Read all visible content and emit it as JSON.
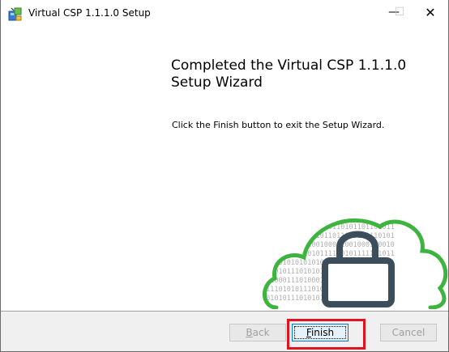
{
  "window": {
    "title": "Virtual CSP 1.1.1.0 Setup",
    "minimize_glyph": "—",
    "maximize_glyph": "☐",
    "close_glyph": "✕"
  },
  "content": {
    "heading": "Completed the Virtual CSP 1.1.1.0 Setup Wizard",
    "body": "Click the Finish button to exit the Setup Wizard."
  },
  "illustration": {
    "binary_lines": [
      "10101010",
      "01101011",
      "10110101",
      "00110010",
      "11101011",
      "01010101",
      "10101011",
      "10100011",
      "01110101",
      "10101011"
    ],
    "cloud_color": "#3db43d",
    "lock_color": "#3c4e5c"
  },
  "buttons": {
    "back_first": "B",
    "back_rest": "ack",
    "finish_first": "F",
    "finish_rest": "inish",
    "cancel": "Cancel"
  }
}
